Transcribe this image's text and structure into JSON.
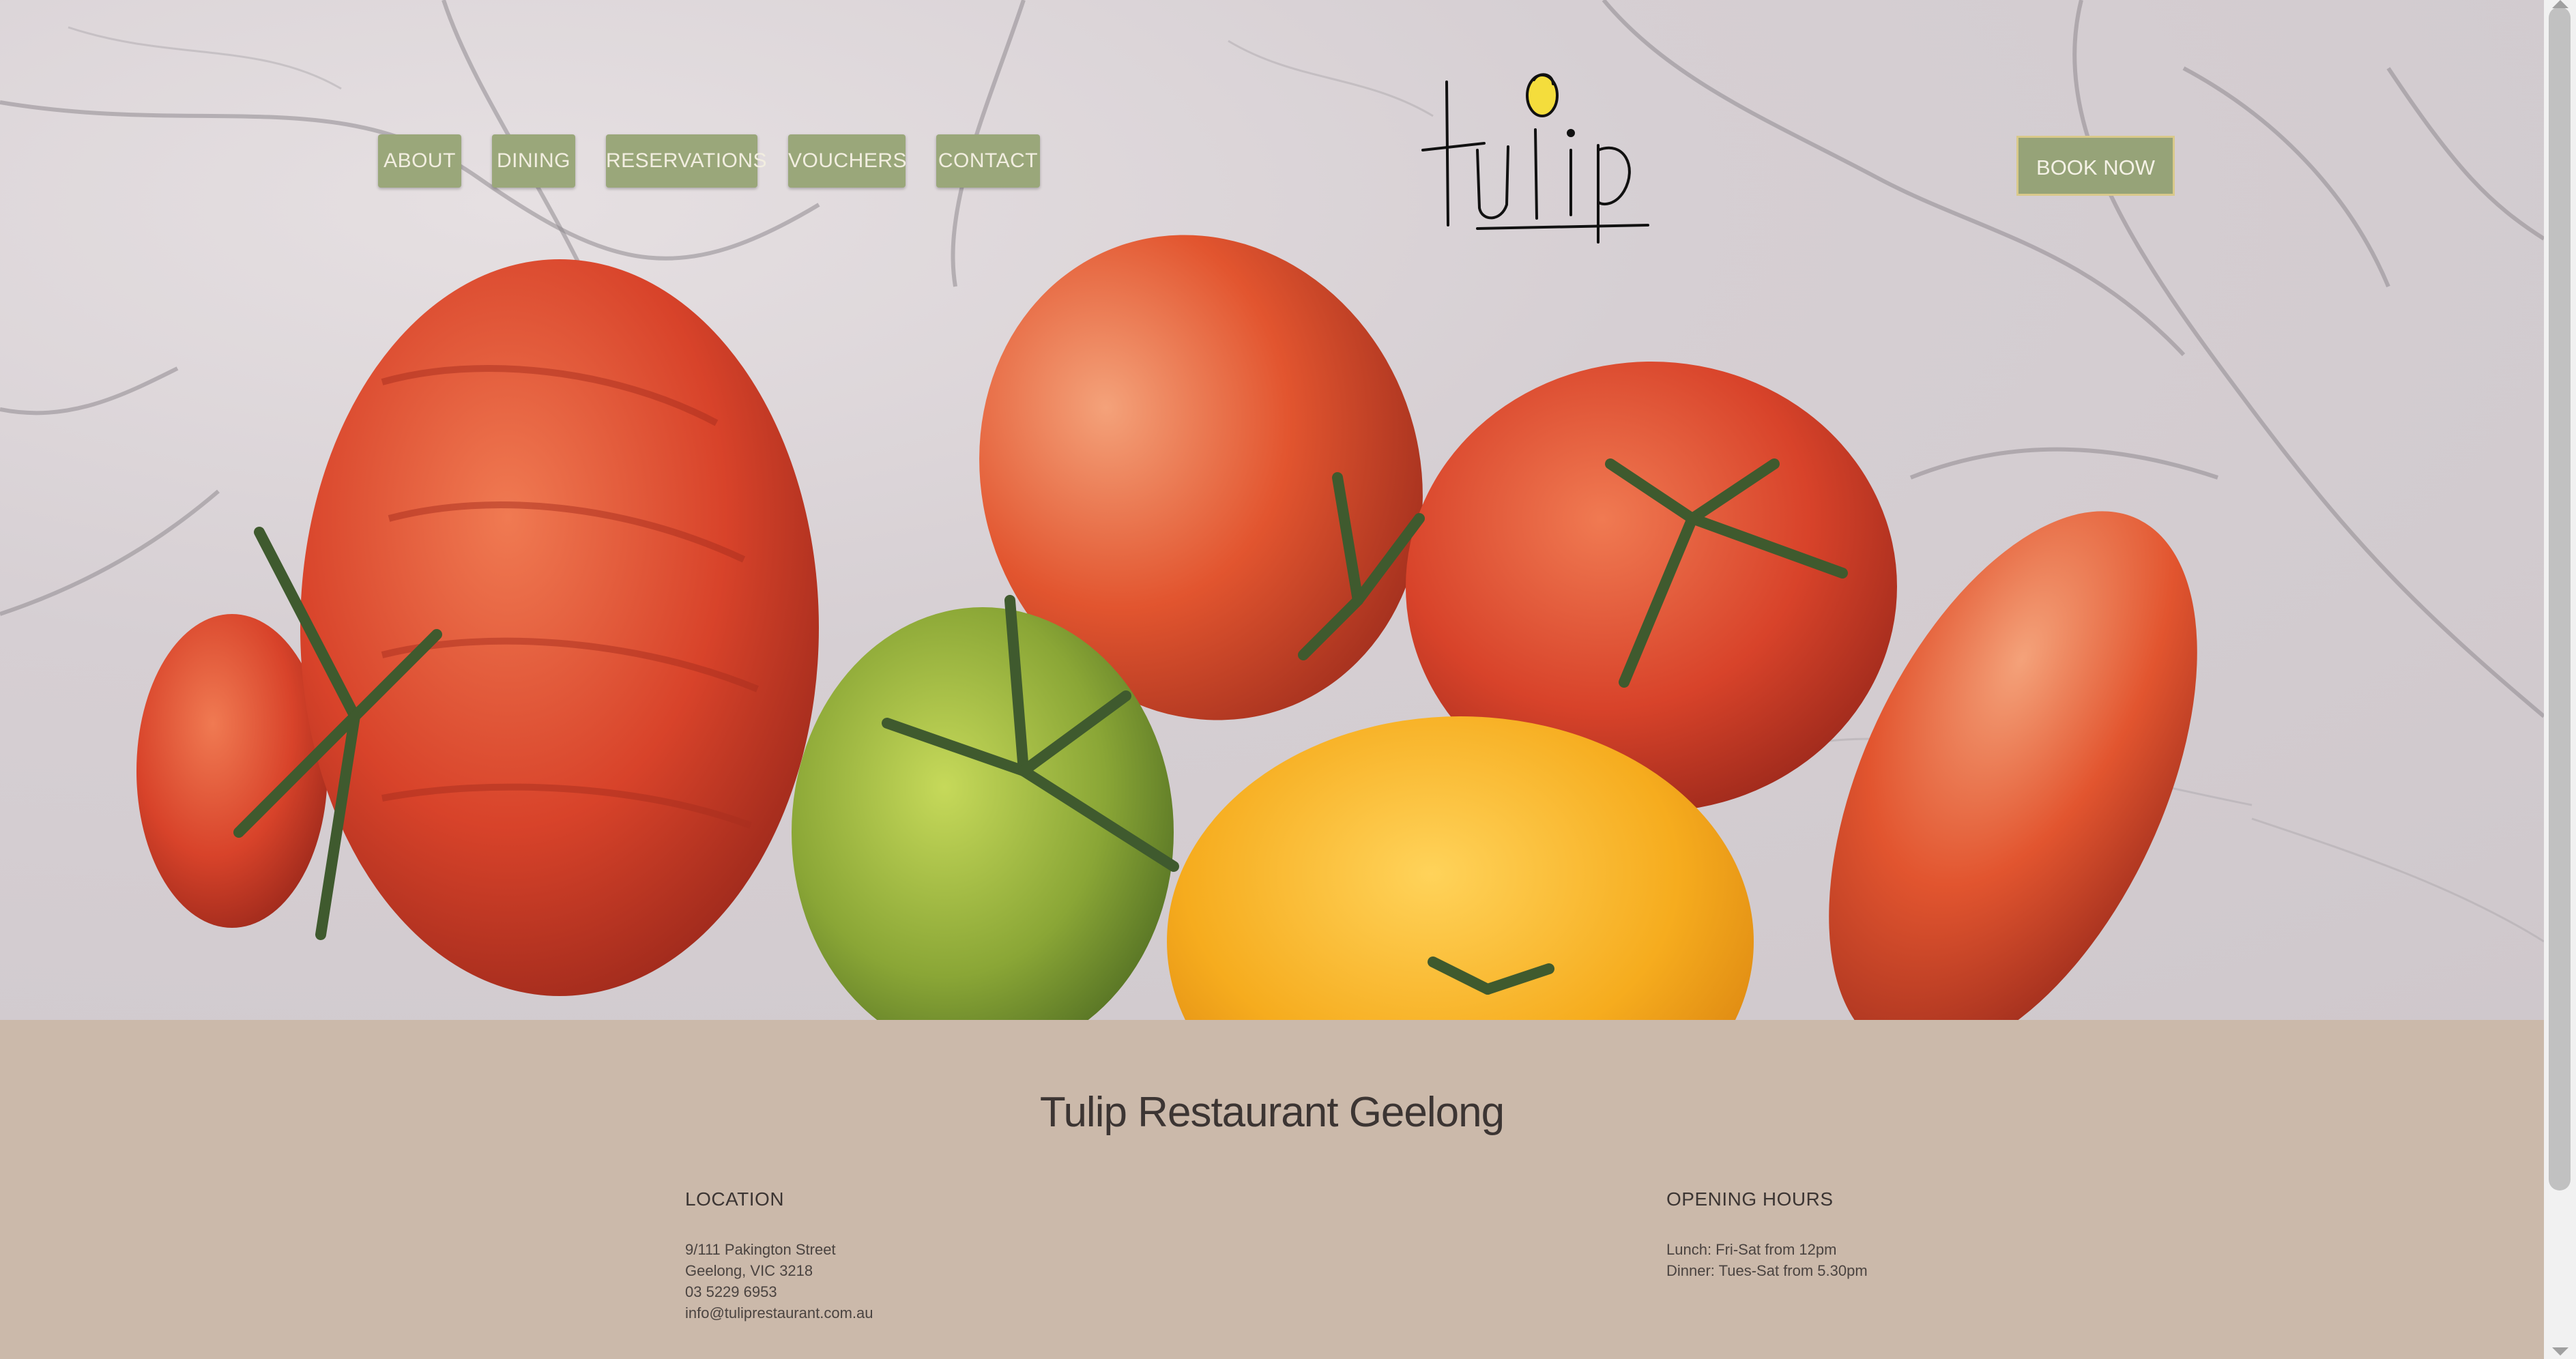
{
  "nav": {
    "items": [
      {
        "label": "ABOUT"
      },
      {
        "label": "DINING"
      },
      {
        "label": "RESERVATIONS"
      },
      {
        "label": "VOUCHERS"
      },
      {
        "label": "CONTACT"
      }
    ],
    "book_label": "BOOK NOW"
  },
  "logo": {
    "text": "tulip"
  },
  "footer": {
    "title": "Tulip Restaurant Geelong",
    "location": {
      "heading": "LOCATION",
      "address1": "9/111 Pakington Street",
      "address2": "Geelong, VIC 3218",
      "phone": "03 5229 6953",
      "email": "info@tuliprestaurant.com.au"
    },
    "hours": {
      "heading": "OPENING HOURS",
      "lunch": "Lunch: Fri-Sat from 12pm",
      "dinner": "Dinner: Tues-Sat from 5.30pm"
    }
  },
  "colors": {
    "nav_green": "#9aa77a",
    "footer_bg": "#cbb9aa",
    "book_border": "#d9c98a"
  }
}
